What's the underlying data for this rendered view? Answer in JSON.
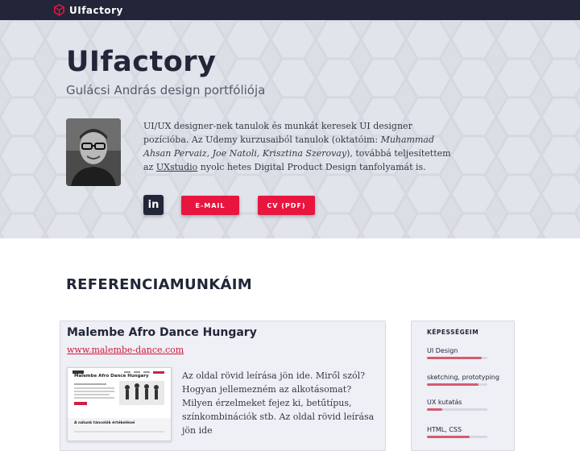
{
  "brand": {
    "name": "UIfactory",
    "icon": "cube-logo-icon"
  },
  "hero": {
    "title": "UIfactory",
    "subtitle": "Gulácsi András design portfóliója",
    "bio": {
      "part1": "UI/UX designer-nek tanulok és munkát keresek UI designer pozícióba. Az Udemy kurzusaiból tanulok (oktatóim: ",
      "instructors": "Muhammad Ahsan Pervaiz, Joe Natoli, Krisztina Szerovay",
      "part2": "), továbbá teljesítettem az ",
      "link": "UXstudio",
      "part3": " nyolc hetes Digital Product Design tanfolyamát is."
    },
    "linkedin_icon": "in",
    "email_label": "E-MAIL",
    "cv_label": "CV (PDF)"
  },
  "references": {
    "title": "REFERENCIAMUNKÁIM",
    "project": {
      "title": "Malembe Afro Dance Hungary",
      "url": "www.malembe-dance.com",
      "description": "Az oldal rövid leírása jön ide. Miről szól? Hogyan jellemezném az alkotásomat? Milyen érzelmeket fejez ki, betűtípus, színkombinációk stb. Az oldal rövid leírása jön ide",
      "thumbnail": {
        "site_title": "Malembe Afro Dance Hungary",
        "section_label": "A nálunk táncolók értékelései"
      }
    }
  },
  "skills": {
    "title": "KÉPESSÉGEIM",
    "items": [
      {
        "label": "UI Design",
        "level": 0.9
      },
      {
        "label": "sketching, prototyping",
        "level": 0.85
      },
      {
        "label": "UX kutatás",
        "level": 0.25
      },
      {
        "label": "HTML, CSS",
        "level": 0.7
      }
    ]
  },
  "colors": {
    "accent": "#e8163f",
    "dark": "#232639",
    "hero_bg": "#dcdee6",
    "skill_bar": "#d85a6e"
  }
}
